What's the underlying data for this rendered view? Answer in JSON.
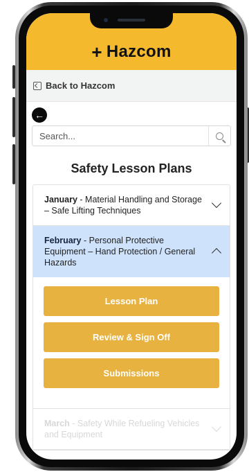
{
  "app": {
    "brand": "Hazcom",
    "brand_symbol": "+",
    "accent_color": "#f5b92e",
    "button_color": "#e8b240",
    "active_item_color": "#cfe2fb"
  },
  "nav": {
    "back_label": "Back to Hazcom"
  },
  "search": {
    "placeholder": "Search..."
  },
  "page": {
    "title": "Safety Lesson Plans"
  },
  "lessons": [
    {
      "month": "January",
      "topic": " - Material Handling and Storage – Safe Lifting Techniques",
      "expanded": false
    },
    {
      "month": "February",
      "topic": " - Personal Protective Equipment – Hand Protection / General Hazards",
      "expanded": true,
      "actions": [
        "Lesson Plan",
        "Review & Sign Off",
        "Submissions"
      ]
    },
    {
      "month": "March",
      "topic": " - Safety While Refueling Vehicles and Equipment",
      "expanded": false
    }
  ],
  "icons": {
    "back": "back-arrow-box-icon",
    "circle_back": "circle-back-arrow-icon",
    "search": "search-icon",
    "chevron_down": "chevron-down-icon",
    "chevron_up": "chevron-up-icon"
  }
}
